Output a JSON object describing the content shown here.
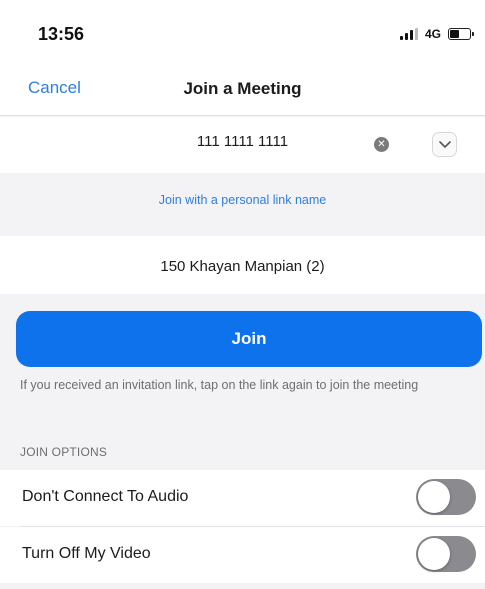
{
  "status_bar": {
    "time": "13:56",
    "network": "4G",
    "battery_level": 0.45
  },
  "nav": {
    "cancel_label": "Cancel",
    "title": "Join a Meeting"
  },
  "meeting_id": {
    "value": "111 1111 1111",
    "clear_icon": "clear-icon",
    "dropdown_icon": "chevron-down-icon"
  },
  "personal_link": {
    "label": "Join with a personal link name"
  },
  "name_field": {
    "value": "150 Khayan Manpian (2)"
  },
  "join": {
    "label": "Join",
    "hint": "If you received an invitation link, tap on the link again to join the meeting"
  },
  "options": {
    "header": "JOIN OPTIONS",
    "items": [
      {
        "label": "Don't Connect To Audio",
        "enabled": false
      },
      {
        "label": "Turn Off My Video",
        "enabled": false
      }
    ]
  },
  "colors": {
    "accent": "#0e72ed",
    "link": "#2d7fe0",
    "toggle_off": "#8a8a8f",
    "background": "#f3f3f6"
  }
}
